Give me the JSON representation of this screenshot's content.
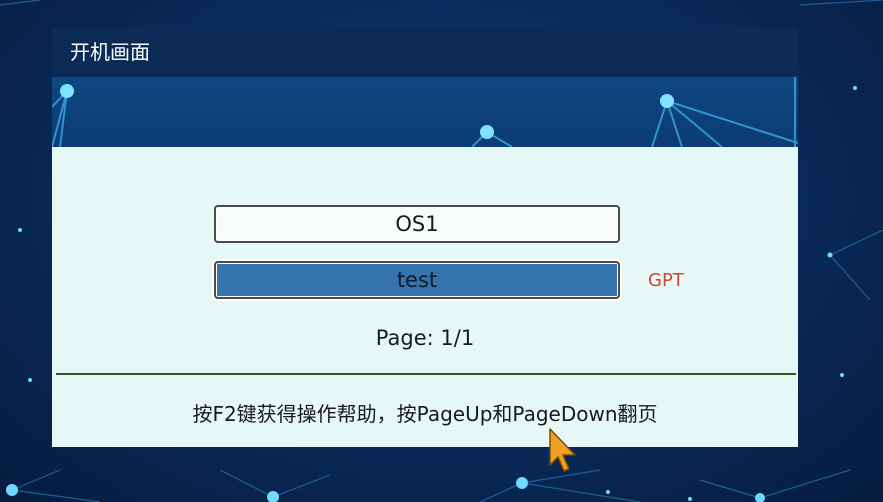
{
  "window": {
    "title": "开机画面"
  },
  "boot_menu": {
    "entries": [
      {
        "label": "OS1",
        "selected": false
      },
      {
        "label": "test",
        "selected": true,
        "badge": "GPT"
      }
    ],
    "page_indicator": "Page: 1/1"
  },
  "help_text": "按F2键获得操作帮助，按PageUp和PageDown翻页",
  "icons": {
    "cursor": "mouse-pointer-icon"
  },
  "colors": {
    "background": "#0a2d5e",
    "titlebar": "#0b2a55",
    "content_bg": "#e6f8f6",
    "selected_entry": "#3573ac",
    "badge": "#d0452e"
  }
}
